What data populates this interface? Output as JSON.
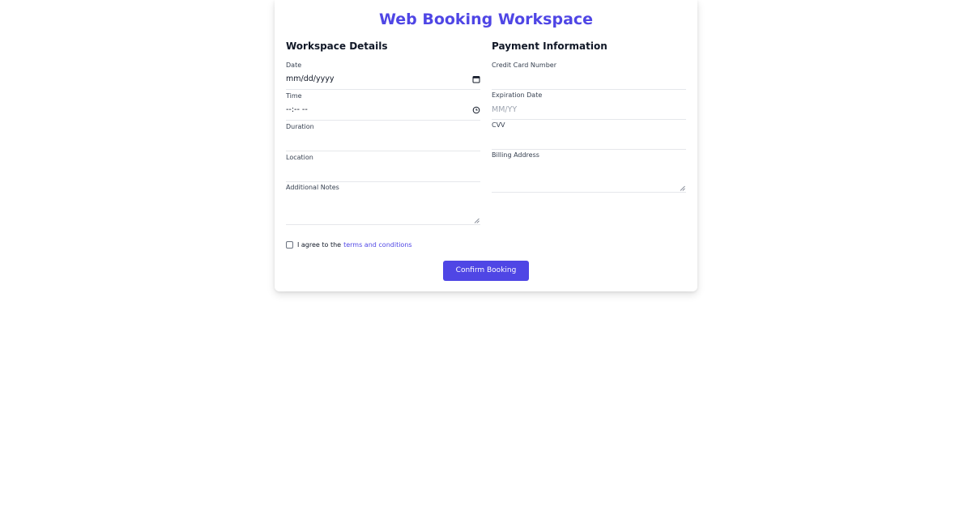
{
  "page": {
    "title": "Web Booking Workspace"
  },
  "workspace": {
    "heading": "Workspace Details",
    "date": {
      "label": "Date",
      "value": "mm/dd/yyyy",
      "icon": "calendar-icon"
    },
    "time": {
      "label": "Time",
      "value": "--:-- --",
      "icon": "clock-icon"
    },
    "duration": {
      "label": "Duration",
      "value": ""
    },
    "location": {
      "label": "Location",
      "value": ""
    },
    "notes": {
      "label": "Additional Notes",
      "value": ""
    }
  },
  "payment": {
    "heading": "Payment Information",
    "card_number": {
      "label": "Credit Card Number",
      "value": ""
    },
    "expiration": {
      "label": "Expiration Date",
      "placeholder": "MM/YY"
    },
    "cvv": {
      "label": "CVV",
      "value": ""
    },
    "billing": {
      "label": "Billing Address",
      "value": ""
    }
  },
  "agreement": {
    "prefix": "I agree to the",
    "link_text": "terms and conditions",
    "checked": false
  },
  "actions": {
    "confirm_label": "Confirm Booking"
  },
  "colors": {
    "accent": "#4f46e5",
    "text": "#111827",
    "border": "#e5e7eb"
  }
}
